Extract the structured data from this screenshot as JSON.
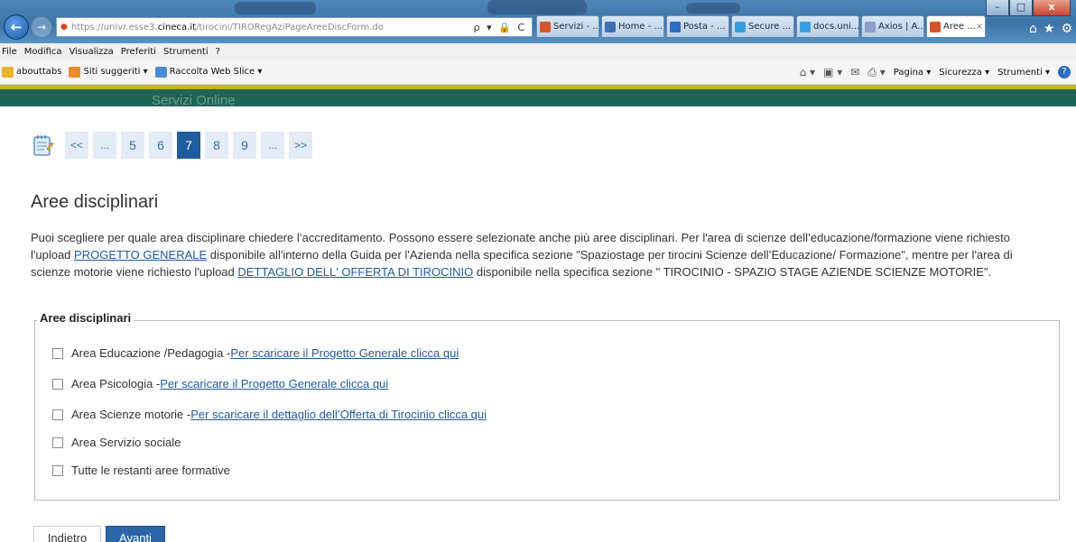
{
  "browser": {
    "url_prefix": "https://univr.esse3.",
    "url_domain": "cineca.it",
    "url_path": "/tirocini/TIRORegAziPageAreeDiscForm.do",
    "address_tools": "ρ ▾ 🔒 C",
    "tabs": [
      {
        "label": "Servizi - ...",
        "icon_color": "#d9542b"
      },
      {
        "label": "Home - ...",
        "icon_color": "#3d6fb2"
      },
      {
        "label": "Posta - ...",
        "icon_color": "#2b6cc4"
      },
      {
        "label": "Secure ...",
        "icon_color": "#3a9de0"
      },
      {
        "label": "docs.uni...",
        "icon_color": "#3a9de0"
      },
      {
        "label": "Axios | A...",
        "icon_color": "#8aa0c8"
      },
      {
        "label": "Aree ...",
        "icon_color": "#d9542b",
        "close": "×"
      }
    ],
    "window_controls": {
      "minimize": "–",
      "maximize": "□",
      "close": "x"
    },
    "right_icons": {
      "home": "⌂",
      "star": "★",
      "gear": "⚙"
    },
    "menu": [
      "File",
      "Modifica",
      "Visualizza",
      "Preferiti",
      "Strumenti",
      "?"
    ],
    "favorites": [
      {
        "label": "abouttabs",
        "icon_color": "#e8b62a"
      },
      {
        "label": "Siti suggeriti ▾",
        "icon_color": "#e88b2a"
      },
      {
        "label": "Raccolta Web Slice ▾",
        "icon_color": "#4a8ad4"
      }
    ],
    "command_bar": [
      "Pagina ▾",
      "Sicurezza ▾",
      "Strumenti ▾"
    ]
  },
  "site": {
    "header_title": "Servizi Online"
  },
  "pager": {
    "items": [
      "<<",
      "...",
      "5",
      "6",
      "7",
      "8",
      "9",
      "...",
      ">>"
    ],
    "current": "7"
  },
  "main": {
    "heading": "Aree disciplinari",
    "intro_1": "Puoi scegliere per quale area disciplinare chiedere l’accreditamento. Possono essere selezionate anche più aree disciplinari. Per l'area di scienze dell’educazione/formazione viene richiesto l'upload ",
    "intro_link_1": "PROGETTO GENERALE",
    "intro_2": " disponibile all'interno della Guida per l'Azienda nella specifica sezione \"Spaziostage per tirocini Scienze dell’Educazione/ Formazione\", mentre per l'area di scienze motorie viene richiesto l'upload ",
    "intro_link_2": "DETTAGLIO DELL' OFFERTA DI TIROCINIO",
    "intro_3": " disponibile nella specifica sezione \" TIROCINIO - SPAZIO STAGE AZIENDE SCIENZE MOTORIE\"."
  },
  "fieldset": {
    "legend": "Aree disciplinari",
    "options": [
      {
        "label": "Area Educazione /Pedagogia - ",
        "link": "Per scaricare il Progetto Generale clicca qui",
        "checked": false
      },
      {
        "label": "Area Psicologia - ",
        "link": "Per scaricare il Progetto Generale clicca qui",
        "checked": false
      },
      {
        "label": "Area Scienze motorie - ",
        "link": "Per scaricare il dettaglio dell’Offerta di Tirocinio clicca qui",
        "checked": false
      },
      {
        "label": "Area Servizio sociale",
        "link": "",
        "checked": false
      },
      {
        "label": "Tutte le restanti aree formative",
        "link": "",
        "checked": false
      }
    ]
  },
  "buttons": {
    "back": "Indietro",
    "next": "Avanti"
  }
}
